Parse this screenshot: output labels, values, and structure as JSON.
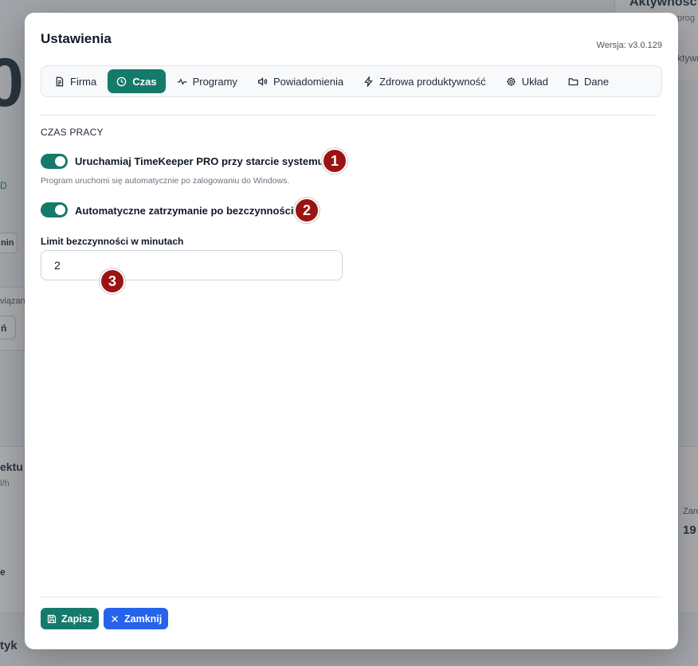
{
  "background": {
    "big_number": "0",
    "right_panel_title": "Aktywnośc",
    "right_panel_sub1": "prog",
    "right_panel_sub2": "ktywno",
    "left_fragment_d": "D",
    "left_fragment_min": "nin",
    "left_fragment_wiazan": "viązan",
    "left_fragment_n": "ń",
    "left_fragment_ektu": "ektu",
    "left_fragment_h": "l/h",
    "left_fragment_e": "e",
    "left_fragment_tyk": "tyk",
    "right_fragment_zar": "Zaro",
    "right_fragment_19": "19"
  },
  "modal": {
    "title": "Ustawienia",
    "version": "Wersja: v3.0.129"
  },
  "tabs": [
    {
      "label": "Firma",
      "icon": "document-icon"
    },
    {
      "label": "Czas",
      "icon": "clock-icon",
      "active": true
    },
    {
      "label": "Programy",
      "icon": "activity-icon"
    },
    {
      "label": "Powiadomienia",
      "icon": "speaker-icon"
    },
    {
      "label": "Zdrowa produktywność",
      "icon": "lightning-icon"
    },
    {
      "label": "Układ",
      "icon": "gear-icon"
    },
    {
      "label": "Dane",
      "icon": "folder-icon"
    }
  ],
  "section": {
    "title": "CZAS PRACY",
    "autostart": {
      "label": "Uruchamiaj TimeKeeper PRO przy starcie systemu",
      "hint": "Program uruchomi się automatycznie po zalogowaniu do Windows.",
      "enabled": true
    },
    "idle_stop": {
      "label": "Automatyczne zatrzymanie po bezczynności",
      "enabled": true
    },
    "idle_limit": {
      "label": "Limit bezczynności w minutach",
      "value": "2"
    }
  },
  "markers": [
    "1",
    "2",
    "3"
  ],
  "buttons": {
    "save": "Zapisz",
    "close": "Zamknij"
  },
  "colors": {
    "accent": "#167a6a",
    "close_button": "#2563eb",
    "marker": "#9b1414"
  }
}
